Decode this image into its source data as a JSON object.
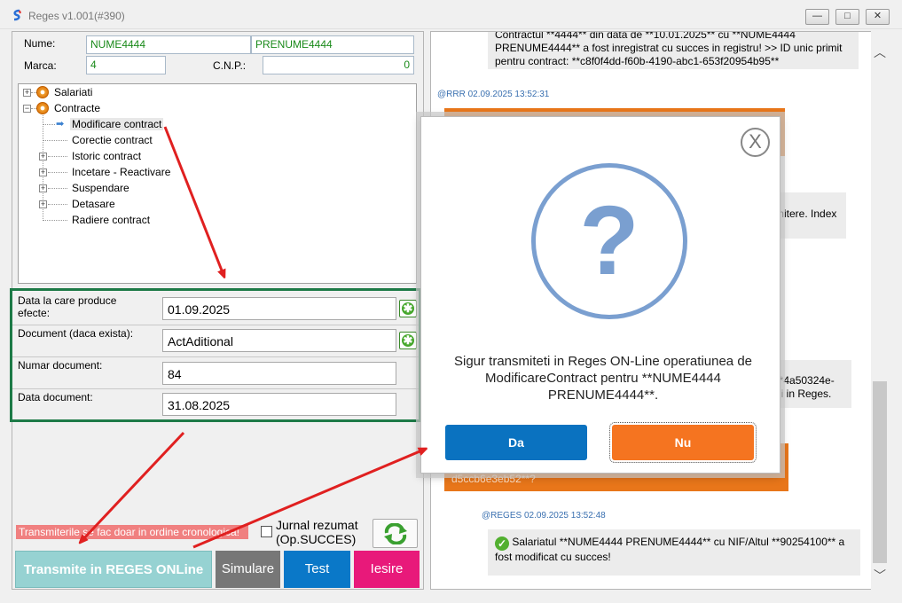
{
  "window": {
    "title": "Reges v1.001(#390)",
    "controls": [
      "—",
      "□",
      "✕"
    ]
  },
  "form": {
    "nume_label": "Nume:",
    "nume_value": "NUME4444",
    "prenume_value": "PRENUME4444",
    "marca_label": "Marca:",
    "marca_value": "4",
    "cnp_label": "C.N.P.:",
    "cnp_value": "0"
  },
  "tree": {
    "salariati": "Salariati",
    "contracte": "Contracte",
    "children": [
      "Modificare contract",
      "Corectie contract",
      "Istoric contract",
      "Incetare - Reactivare",
      "Suspendare",
      "Detasare",
      "Radiere contract"
    ]
  },
  "details": {
    "data_label": "Data la care produce efecte:",
    "data_value": "01.09.2025",
    "doc_label": "Document (daca exista):",
    "doc_value": "ActAditional",
    "numar_label": "Numar document:",
    "numar_value": "84",
    "datadoc_label": "Data document:",
    "datadoc_value": "31.08.2025"
  },
  "bottom": {
    "warning": "Transmiterile se fac doar in ordine cronologica!",
    "jurnal_label_1": "Jurnal rezumat",
    "jurnal_label_2": "(Op.SUCCES)",
    "transmite": "Transmite in REGES ONLine",
    "simulare": "Simulare",
    "test": "Test",
    "iesire": "Iesire"
  },
  "messages": {
    "m1": "Contractul **4444** din data de **10.01.2025** cu **NUME4444 PRENUME4444** a fost inregistrat cu succes in registru! >> ID unic primit pentru contract: **c8f0f4dd-f60b-4190-abc1-653f20954b95**",
    "stamp1": "@RRR 02.09.2025 13:52:31",
    "m2_tail": "mitere. Index",
    "m3_a": "**4a50324e-",
    "m3_b": "rii in Reges.",
    "m4_tail": "d5ccb6e3eb52**?",
    "stamp2": "@REGES 02.09.2025 13:52:48",
    "m5": "Salariatul **NUME4444 PRENUME4444** cu NIF/Altul **90254100** a fost modificat cu succes!"
  },
  "dialog": {
    "close": "X",
    "question": "?",
    "text": "Sigur transmiteti in Reges ON-Line operatiunea de ModificareContract pentru **NUME4444 PRENUME4444**.",
    "yes": "Da",
    "no": "Nu"
  },
  "colors": {
    "transmite": "#96d2d2",
    "simulare": "#777777",
    "test": "#0a78c8",
    "iesire": "#e8197a",
    "da": "#0a72c0",
    "nu": "#f57420",
    "form_border": "#1d7a47",
    "arrow": "#e02020"
  }
}
